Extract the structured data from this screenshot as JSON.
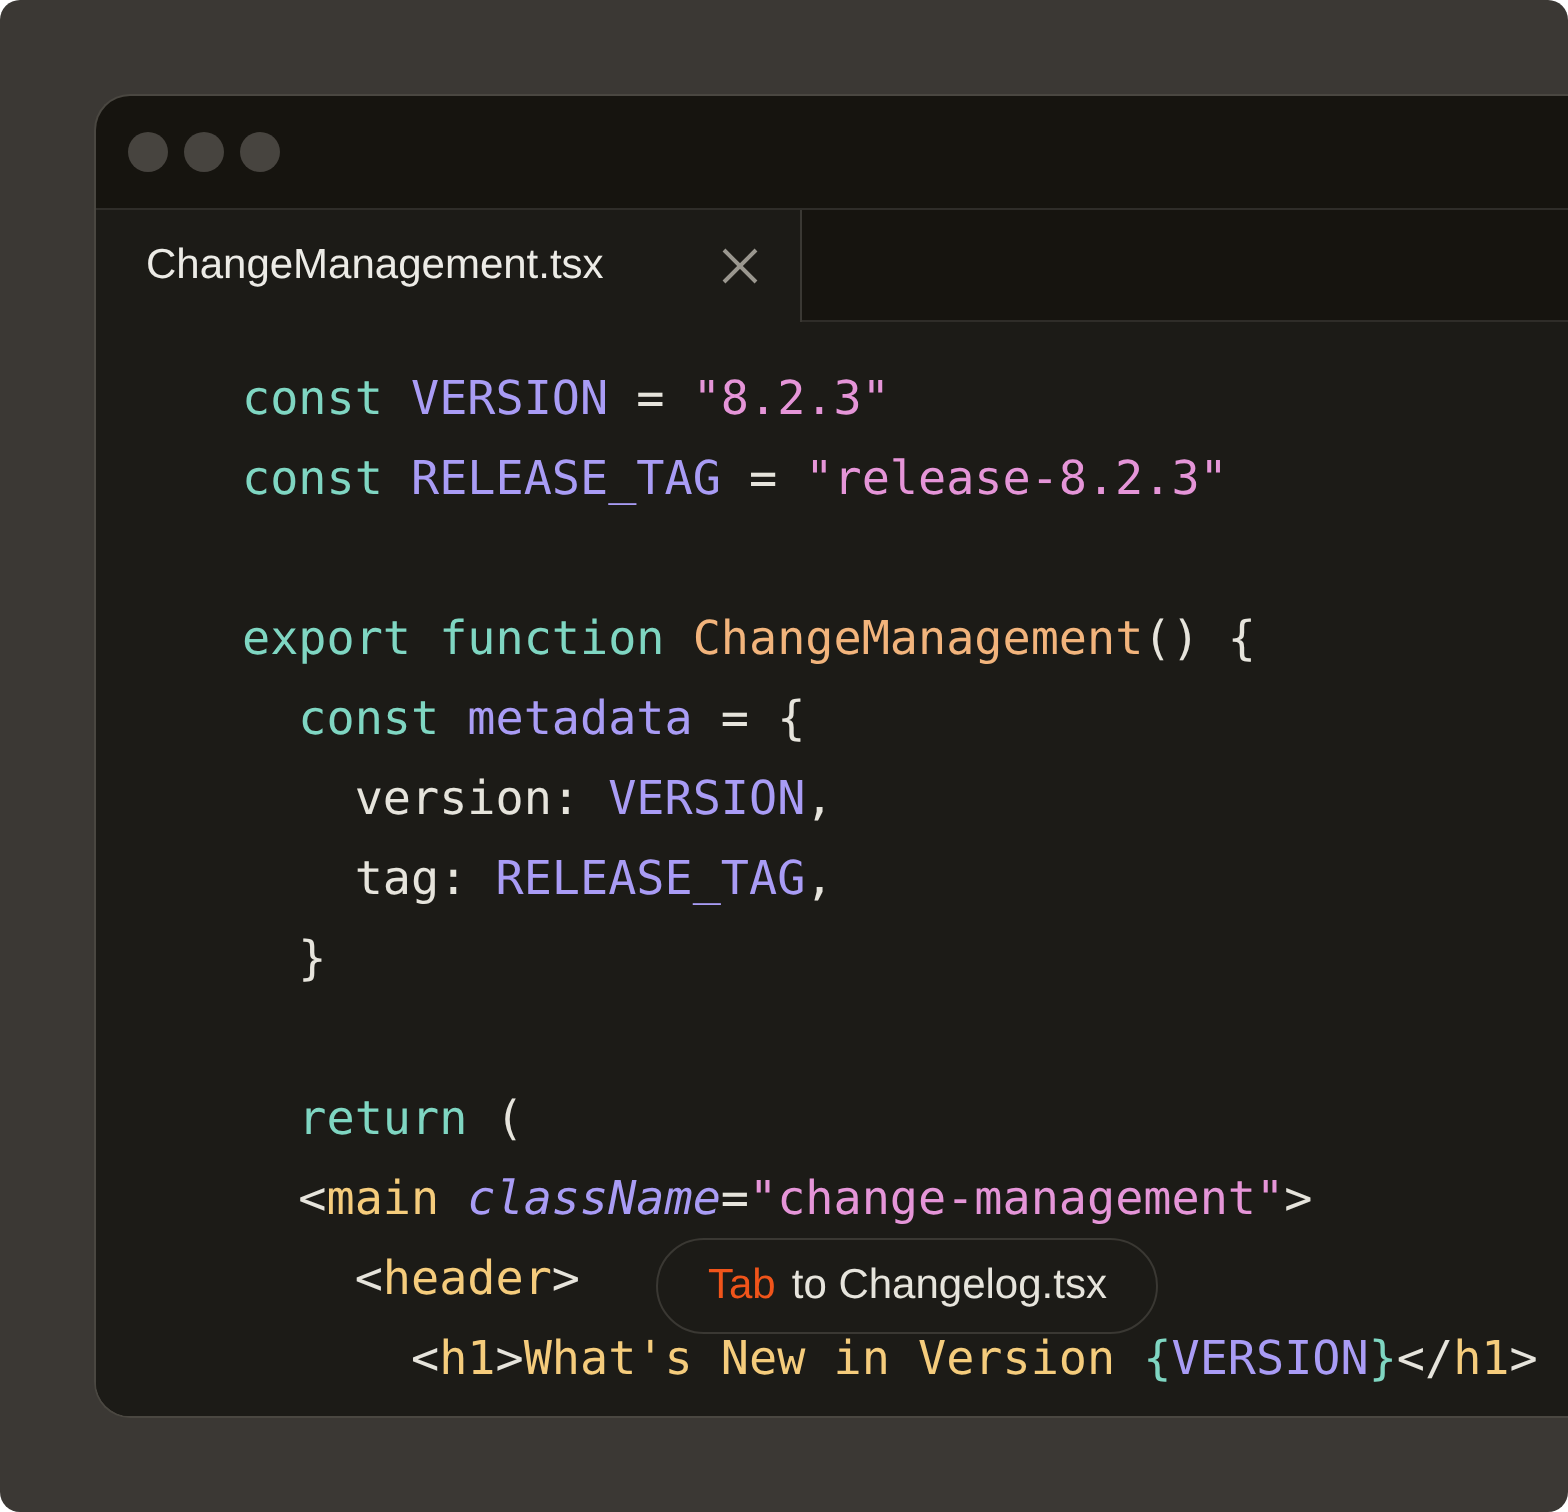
{
  "tabs": [
    {
      "label": "ChangeManagement.tsx",
      "selected": true
    }
  ],
  "code": [
    {
      "tokens": [
        {
          "text": "const ",
          "kind": "keyword"
        },
        {
          "text": "VERSION",
          "kind": "identifier"
        },
        {
          "text": " = "
        },
        {
          "text": "\"8.2.3\"",
          "kind": "string"
        }
      ]
    },
    {
      "tokens": [
        {
          "text": "const ",
          "kind": "keyword"
        },
        {
          "text": "RELEASE_TAG",
          "kind": "identifier"
        },
        {
          "text": " = "
        },
        {
          "text": "\"release-8.2.3\"",
          "kind": "string"
        }
      ]
    },
    {
      "blank": true
    },
    {
      "tokens": [
        {
          "text": "export function ",
          "kind": "keyword"
        },
        {
          "text": "ChangeManagement",
          "kind": "function"
        },
        {
          "text": "() {"
        }
      ],
      "children": [
        {
          "tokens": [
            {
              "text": "const ",
              "kind": "keyword"
            },
            {
              "text": "metadata",
              "kind": "identifier"
            },
            {
              "text": " = {"
            }
          ],
          "children": [
            {
              "tokens": [
                {
                  "text": "version: "
                },
                {
                  "text": "VERSION",
                  "kind": "identifier"
                },
                {
                  "text": ","
                }
              ]
            },
            {
              "tokens": [
                {
                  "text": "tag: "
                },
                {
                  "text": "RELEASE_TAG",
                  "kind": "identifier"
                },
                {
                  "text": ","
                }
              ]
            }
          ]
        },
        {
          "tokens": [
            {
              "text": "}"
            }
          ]
        },
        {
          "blank": true
        },
        {
          "tokens": [
            {
              "text": "return",
              "kind": "keyword"
            },
            {
              "text": " ("
            }
          ]
        },
        {
          "tokens": [
            {
              "text": "<"
            },
            {
              "text": "main",
              "kind": "tag"
            },
            {
              "text": " className",
              "kind": "attribute"
            },
            {
              "text": "="
            },
            {
              "text": "\"change-management\"",
              "kind": "string"
            },
            {
              "text": ">"
            }
          ],
          "children": [
            {
              "tokens": [
                {
                  "text": "<"
                },
                {
                  "text": "header",
                  "kind": "tag"
                },
                {
                  "text": ">"
                }
              ],
              "children": [
                {
                  "tokens": [
                    {
                      "text": "<"
                    },
                    {
                      "text": "h1",
                      "kind": "tag"
                    },
                    {
                      "text": ">"
                    },
                    {
                      "text": "What's New in Version ",
                      "kind": "tag"
                    },
                    {
                      "text": "{",
                      "kind": "keyword"
                    },
                    {
                      "text": "VERSION",
                      "kind": "identifier"
                    },
                    {
                      "text": "}",
                      "kind": "keyword"
                    },
                    {
                      "text": "</"
                    },
                    {
                      "text": "h1",
                      "kind": "tag"
                    },
                    {
                      "text": ">"
                    }
                  ]
                }
              ]
            }
          ]
        }
      ]
    }
  ],
  "hint": {
    "key": "Tab",
    "text": "to Changelog.tsx"
  }
}
